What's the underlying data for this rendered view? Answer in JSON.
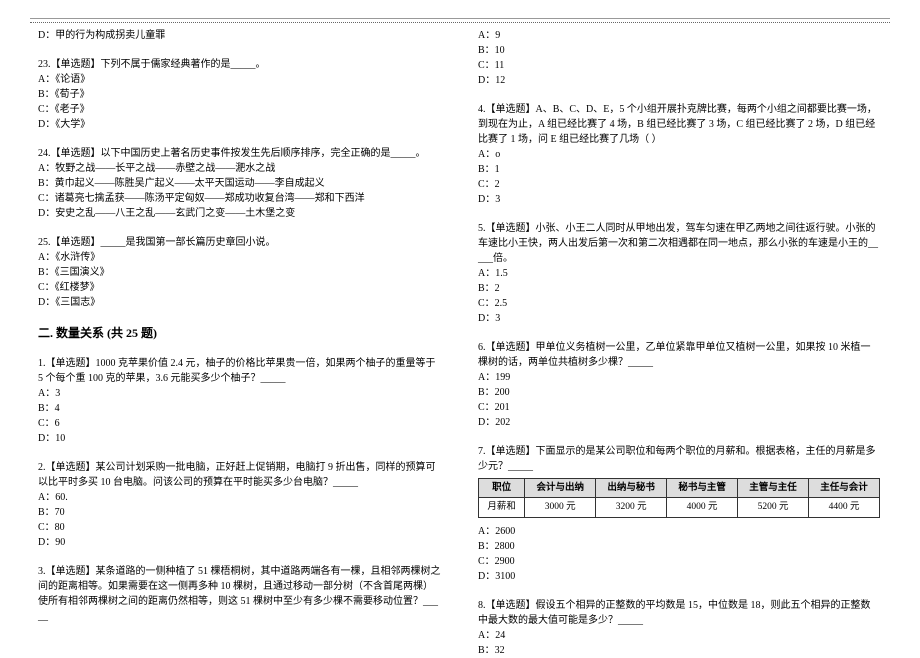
{
  "left": {
    "q22_opt_d": "D：甲的行为构成拐卖儿童罪",
    "q23": {
      "stem": "23.【单选题】下列不属于儒家经典著作的是_____。",
      "a": "A：《论语》",
      "b": "B：《荀子》",
      "c": "C：《老子》",
      "d": "D：《大学》"
    },
    "q24": {
      "stem": "24.【单选题】以下中国历史上著名历史事件按发生先后顺序排序，完全正确的是_____。",
      "a": "A：牧野之战——长平之战——赤壁之战——淝水之战",
      "b": "B：黄巾起义——陈胜吴广起义——太平天国运动——李自成起义",
      "c": "C：诸葛亮七擒孟获——陈汤平定匈奴——郑成功收复台湾——郑和下西洋",
      "d": "D：安史之乱——八王之乱——玄武门之变——土木堡之变"
    },
    "q25": {
      "stem": "25.【单选题】_____是我国第一部长篇历史章回小说。",
      "a": "A：《水浒传》",
      "b": "B：《三国演义》",
      "c": "C：《红楼梦》",
      "d": "D：《三国志》"
    },
    "section2_title": "二. 数量关系 (共 25 题)",
    "s2q1": {
      "stem": "1.【单选题】1000 克苹果价值 2.4 元，柚子的价格比苹果贵一倍，如果两个柚子的重量等于 5 个每个重 100 克的苹果，3.6 元能买多少个柚子？_____",
      "a": "A：3",
      "b": "B：4",
      "c": "C：6",
      "d": "D：10"
    },
    "s2q2": {
      "stem": "2.【单选题】某公司计划采购一批电脑，正好赶上促销期，电脑打 9 折出售，同样的预算可以比平时多买 10 台电脑。问该公司的预算在平时能买多少台电脑？_____",
      "a": "A：60.",
      "b": "B：70",
      "c": "C：80",
      "d": "D：90"
    },
    "s2q3": {
      "stem": "3.【单选题】某条道路的一侧种植了 51 棵梧桐树，其中道路两端各有一棵，且相邻两棵树之间的距离相等。如果需要在这一侧再多种 10 棵树，且通过移动一部分树（不含首尾两棵）使所有相邻两棵树之间的距离仍然相等，则这 51 棵树中至少有多少棵不需要移动位置？_____"
    }
  },
  "right": {
    "s2q3_opts": {
      "a": "A：9",
      "b": "B：10",
      "c": "C：11",
      "d": "D：12"
    },
    "s2q4": {
      "stem": "4.【单选题】A、B、C、D、E，5 个小组开展扑克牌比赛，每两个小组之间都要比赛一场，到现在为止，A 组已经比赛了 4 场，B 组已经比赛了 3 场，C 组已经比赛了 2 场，D 组已经比赛了 1 场，问 E 组已经比赛了几场（ ）",
      "a": "A：o",
      "b": "B：1",
      "c": "C：2",
      "d": "D：3"
    },
    "s2q5": {
      "stem": "5.【单选题】小张、小王二人同时从甲地出发，驾车匀速在甲乙两地之间往返行驶。小张的车速比小王快，两人出发后第一次和第二次相遇都在同一地点，那么小张的车速是小王的_____倍。",
      "a": "A：1.5",
      "b": "B：2",
      "c": "C：2.5",
      "d": "D：3"
    },
    "s2q6": {
      "stem": "6.【单选题】甲单位义务植树一公里，乙单位紧靠甲单位又植树一公里，如果按 10 米植一棵树的话，两单位共植树多少棵？_____",
      "a": "A：199",
      "b": "B：200",
      "c": "C：201",
      "d": "D：202"
    },
    "s2q7": {
      "stem": "7.【单选题】下面显示的是某公司职位和每两个职位的月薪和。根据表格，主任的月薪是多少元？_____",
      "a": "A：2600",
      "b": "B：2800",
      "c": "C：2900",
      "d": "D：3100"
    },
    "s2q8": {
      "stem": "8.【单选题】假设五个相异的正整数的平均数是 15，中位数是 18，则此五个相异的正整数中最大数的最大值可能是多少？_____",
      "a": "A：24",
      "b": "B：32"
    }
  },
  "chart_data": {
    "type": "table",
    "header": [
      "职位",
      "会计与出纳",
      "出纳与秘书",
      "秘书与主管",
      "主管与主任",
      "主任与会计"
    ],
    "rows": [
      [
        "月薪和",
        "3000 元",
        "3200 元",
        "4000 元",
        "5200 元",
        "4400 元"
      ]
    ]
  }
}
